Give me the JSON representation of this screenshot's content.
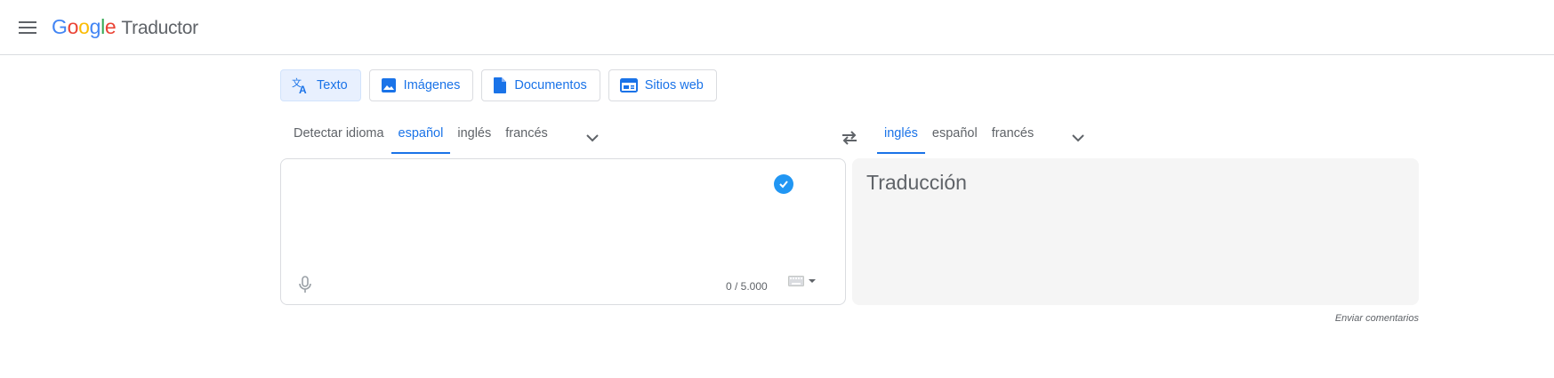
{
  "header": {
    "logo": {
      "g1": "G",
      "o1": "o",
      "o2": "o",
      "g2": "g",
      "l": "l",
      "e": "e",
      "product": "Traductor"
    },
    "menu_icon": "hamburger-menu-icon"
  },
  "modes": [
    {
      "label": "Texto",
      "icon": "translate-icon",
      "active": true
    },
    {
      "label": "Imágenes",
      "icon": "image-icon",
      "active": false
    },
    {
      "label": "Documentos",
      "icon": "document-icon",
      "active": false
    },
    {
      "label": "Sitios web",
      "icon": "website-icon",
      "active": false
    }
  ],
  "source_languages": {
    "tabs": [
      "Detectar idioma",
      "español",
      "inglés",
      "francés"
    ],
    "active": "español"
  },
  "target_languages": {
    "tabs": [
      "inglés",
      "español",
      "francés"
    ],
    "active": "inglés"
  },
  "source": {
    "value": "",
    "char_count": "0 / 5.000"
  },
  "target": {
    "placeholder": "Traducción"
  },
  "feedback": "Enviar comentarios",
  "colors": {
    "accent": "#1a73e8",
    "check_badge": "#2196f3",
    "target_bg": "#f5f5f5"
  }
}
